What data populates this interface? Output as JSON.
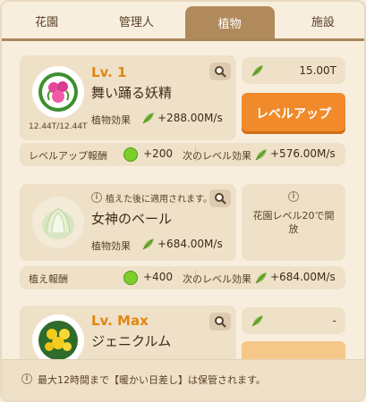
{
  "tabs": [
    "花園",
    "管理人",
    "植物",
    "施設"
  ],
  "active_tab": 2,
  "plants": [
    {
      "level": "Lv. 1",
      "name": "舞い踊る妖精",
      "capacity": "12.44T/12.44T",
      "effect_label": "植物効果",
      "effect_value": "+288.00M/s",
      "cost": "15.00T",
      "action_label": "レベルアップ",
      "reward_label": "レベルアップ報酬",
      "reward_value": "+200",
      "next_label": "次のレベル効果",
      "next_value": "+576.00M/s"
    },
    {
      "notice": "植えた後に適用されます。",
      "name": "女神のベール",
      "effect_label": "植物効果",
      "effect_value": "+684.00M/s",
      "lock_text": "花園レベル20で開放",
      "reward_label": "植え報酬",
      "reward_value": "+400",
      "next_label": "次のレベル効果",
      "next_value": "+684.00M/s"
    },
    {
      "level": "Lv. Max",
      "name": "ジェニクルム",
      "cost": "-"
    }
  ],
  "footer_text": "最大12時間まで【暖かい日差し】は保管されます。",
  "colors": {
    "accent_orange": "#f08a2a",
    "level_orange": "#e08612",
    "tab_active": "#b18a5c",
    "card_bg": "#efe1c8"
  }
}
